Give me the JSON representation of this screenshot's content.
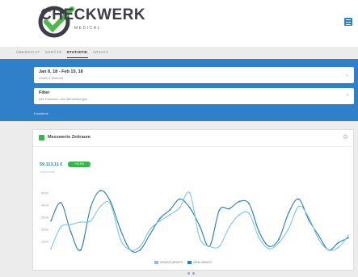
{
  "brand": {
    "name": "CHECKWERK",
    "tagline": "MEDICAL"
  },
  "tabs": [
    {
      "label": "ÜBERSICHT"
    },
    {
      "label": "GERÄTE"
    },
    {
      "label": "STATISTIK"
    },
    {
      "label": "ARCHIV"
    }
  ],
  "filters": {
    "date": {
      "title": "Jan 8, 18 - Feb 15, 18",
      "subtitle": "Letzte 5 Wochen",
      "icon": "chevron-down-icon"
    },
    "filter": {
      "title": "Filter",
      "subtitle": "Alle Patienten, Alle Behandlungen",
      "icon": "search-icon"
    },
    "link": "Erweiterte"
  },
  "card": {
    "title": "Messwerte Zeitraum",
    "icon": "chart-icon",
    "kpi_value": "59.113,11 €",
    "kpi_badge": "+10,5%",
    "kpi_sub": "Vorperiode"
  },
  "chart_data": {
    "type": "line",
    "ylim": [
      0,
      6000
    ],
    "yticks": [
      1000,
      2000,
      3000,
      4000,
      5000
    ],
    "series": [
      {
        "name": "ISSUER UMSATZ",
        "color": "#2a7ab8",
        "values": [
          2700,
          4200,
          1800,
          300,
          3800,
          5200,
          4300,
          2000,
          300,
          300,
          1600,
          2900,
          3600,
          4500,
          3800,
          2300,
          600,
          3600,
          3700,
          4300,
          4100,
          1800,
          600,
          1200,
          3400,
          4500,
          2800,
          1500,
          300,
          900,
          1300
        ]
      },
      {
        "name": "WEB UMSATZ",
        "color": "#7cc7e6",
        "values": [
          400,
          2200,
          2400,
          2600,
          2700,
          3900,
          4100,
          1200,
          300,
          600,
          2000,
          2700,
          3200,
          3800,
          5000,
          1300,
          600,
          600,
          2200,
          3200,
          3300,
          1300,
          400,
          900,
          2100,
          3900,
          3000,
          1200,
          300,
          500,
          1500
        ]
      }
    ],
    "legend_position": "bottom"
  },
  "colors": {
    "accent": "#2f7fc9",
    "success": "#3bb44a",
    "header_bg": "#ffffff"
  }
}
